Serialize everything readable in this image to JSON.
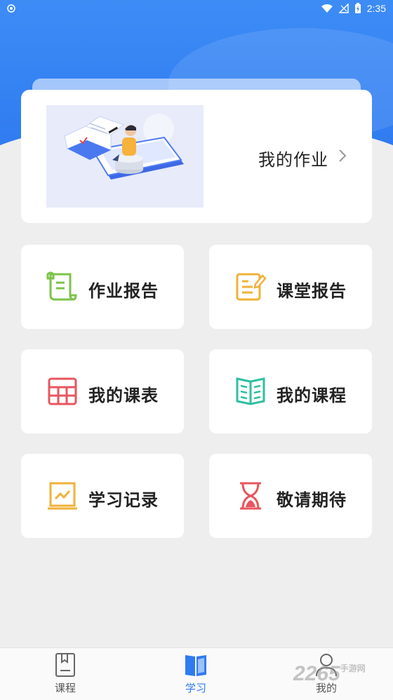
{
  "status_bar": {
    "time": "2:35"
  },
  "homework_card": {
    "title": "我的作业"
  },
  "tiles": [
    {
      "label": "作业报告",
      "icon": "scroll-icon",
      "color": "#7cc34a"
    },
    {
      "label": "课堂报告",
      "icon": "notepad-pen-icon",
      "color": "#f0b13a"
    },
    {
      "label": "我的课表",
      "icon": "table-grid-icon",
      "color": "#e8555f"
    },
    {
      "label": "我的课程",
      "icon": "open-book-icon",
      "color": "#2fbfa0"
    },
    {
      "label": "学习记录",
      "icon": "chart-board-icon",
      "color": "#f0b13a"
    },
    {
      "label": "敬请期待",
      "icon": "hourglass-icon",
      "color": "#e8555f"
    }
  ],
  "bottom_nav": [
    {
      "label": "课程",
      "icon": "course-doc-icon",
      "active": false
    },
    {
      "label": "学习",
      "icon": "study-book-icon",
      "active": true
    },
    {
      "label": "我的",
      "icon": "person-icon",
      "active": false
    }
  ],
  "watermark": {
    "text": "2265",
    "sub": "手游网"
  },
  "colors": {
    "primary": "#2f7bf0",
    "background": "#eeeeee"
  }
}
